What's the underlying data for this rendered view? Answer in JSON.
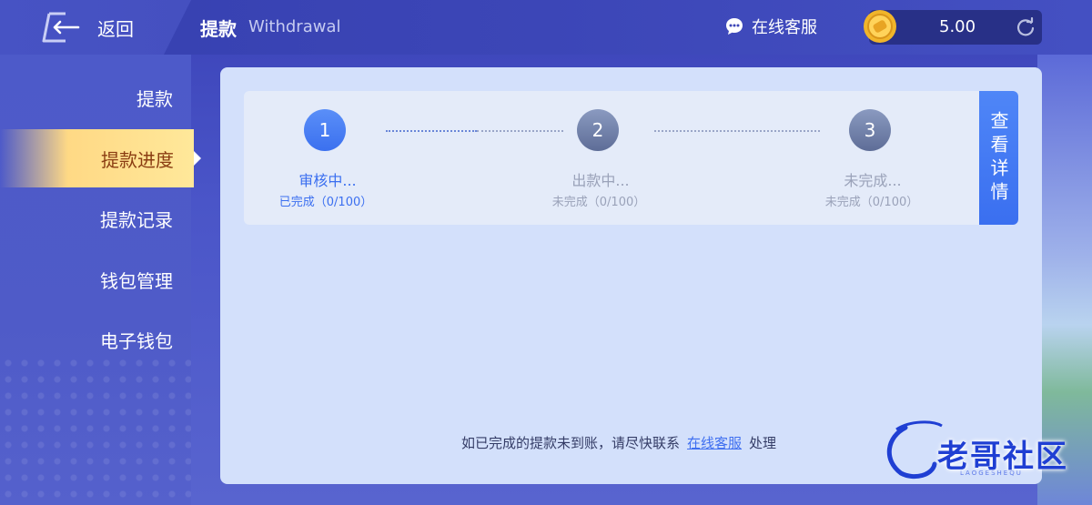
{
  "header": {
    "back_label": "返回",
    "title": "提款",
    "subtitle": "Withdrawal",
    "customer_service_label": "在线客服",
    "balance": "5.00"
  },
  "sidebar": {
    "items": [
      {
        "label": "提款",
        "active": false
      },
      {
        "label": "提款进度",
        "active": true
      },
      {
        "label": "提款记录",
        "active": false
      },
      {
        "label": "钱包管理",
        "active": false
      },
      {
        "label": "电子钱包",
        "active": false
      }
    ]
  },
  "progress": {
    "steps": [
      {
        "number": "1",
        "title": "审核中...",
        "status": "已完成（0/100）",
        "state": "done"
      },
      {
        "number": "2",
        "title": "出款中...",
        "status": "未完成（0/100）",
        "state": "todo"
      },
      {
        "number": "3",
        "title": "未完成...",
        "status": "未完成（0/100）",
        "state": "todo"
      }
    ],
    "detail_button_label": "查看详情"
  },
  "notice": {
    "text": "如已完成的提款未到账，请尽快联系",
    "link_label": "在线客服",
    "suffix": "处理"
  },
  "watermark": {
    "text": "老哥社区",
    "sub": "LAOGESHEQU"
  },
  "colors": {
    "accent": "#3b70ef",
    "active_bg": "#ffe89a",
    "active_text": "#8a3d12",
    "panel_bg": "#d3e0fb"
  }
}
